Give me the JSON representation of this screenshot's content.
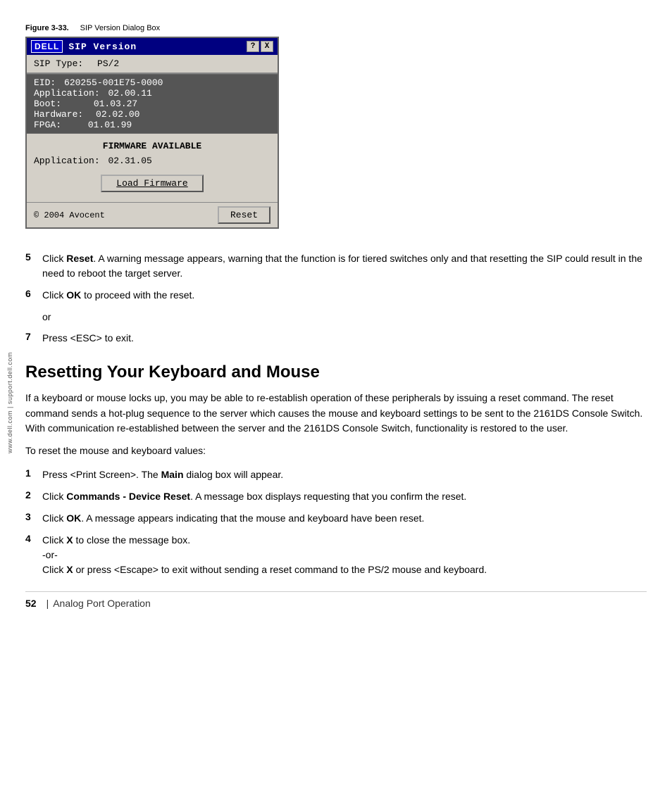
{
  "sidebar": {
    "text": "www.dell.com | support.dell.com"
  },
  "figure": {
    "label": "Figure 3-33.",
    "title": "SIP Version Dialog Box"
  },
  "dialog": {
    "title": "SIP Version",
    "dell_logo": "DELL",
    "help_btn": "?",
    "close_btn": "X",
    "sip_type_label": "SIP Type:",
    "sip_type_value": "PS/2",
    "eid_label": "EID:",
    "eid_value": "620255-001E75-0000",
    "application_label": "Application:",
    "application_value": "02.00.11",
    "boot_label": "Boot:",
    "boot_value": "01.03.27",
    "hardware_label": "Hardware:",
    "hardware_value": "02.02.00",
    "fpga_label": "FPGA:",
    "fpga_value": "01.01.99",
    "firmware_header": "FIRMWARE AVAILABLE",
    "firmware_app_label": "Application:",
    "firmware_app_value": "02.31.05",
    "load_firmware_btn": "Load Firmware",
    "copyright": "© 2004 Avocent",
    "reset_btn": "Reset"
  },
  "steps": [
    {
      "num": "5",
      "text": "Click Reset. A warning message appears, warning that the function is for tiered switches only and that resetting the SIP could result in the need to reboot the target server."
    },
    {
      "num": "6",
      "text": "Click OK to proceed with the reset."
    },
    {
      "num": "7",
      "text": "Press <ESC> to exit."
    }
  ],
  "or_text": "or",
  "section_heading": "Resetting Your Keyboard and Mouse",
  "section_paragraphs": [
    "If a keyboard or mouse locks up, you may be able to re-establish operation of these peripherals by issuing a reset command. The reset command sends a hot-plug sequence to the server which causes the mouse and keyboard settings to be sent to the 2161DS Console Switch. With communication re-established between the server and the 2161DS Console Switch, functionality is restored to the user.",
    "To reset the mouse and keyboard values:"
  ],
  "kb_steps": [
    {
      "num": "1",
      "text": "Press <Print Screen>. The Main dialog box will appear."
    },
    {
      "num": "2",
      "text": "Click Commands - Device Reset. A message box displays requesting that you confirm the reset."
    },
    {
      "num": "3",
      "text": "Click OK. A message appears indicating that the mouse and keyboard have been reset."
    },
    {
      "num": "4",
      "text_parts": [
        "Click X to close the message box.",
        "-or-",
        "Click X or press <Escape> to exit without sending a reset command to the PS/2 mouse and keyboard."
      ]
    }
  ],
  "footer": {
    "page_number": "52",
    "separator": "|",
    "section": "Analog Port Operation"
  }
}
